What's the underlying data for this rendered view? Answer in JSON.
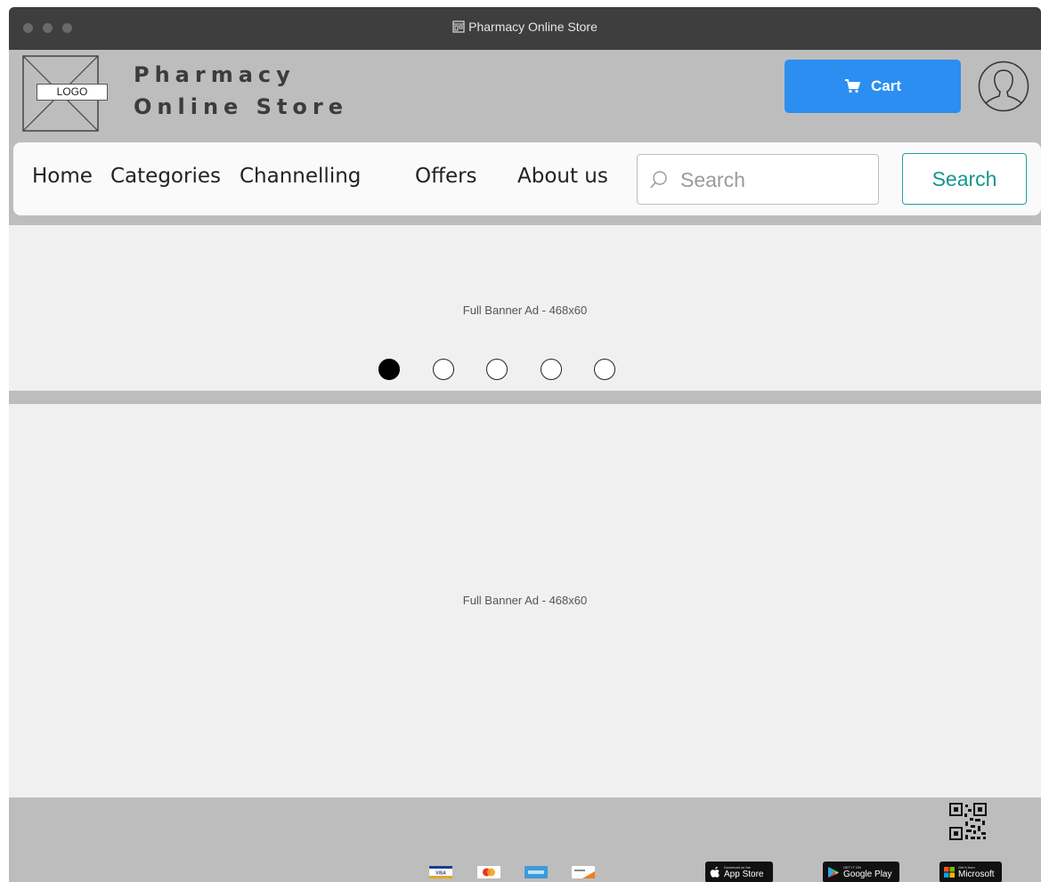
{
  "window": {
    "title": "Pharmacy Online Store"
  },
  "header": {
    "logo_label": "LOGO",
    "brand_line1": "Pharmacy",
    "brand_line2": "Online Store",
    "cart_label": "Cart"
  },
  "nav": {
    "items": [
      "Home",
      "Categories",
      "Channelling",
      "Offers",
      "About us"
    ],
    "search_placeholder": "Search",
    "search_button": "Search"
  },
  "banners": {
    "banner1_text": "Full Banner Ad - 468x60",
    "banner2_text": "Full Banner Ad - 468x60",
    "carousel_active_index": 0,
    "carousel_count": 5
  },
  "footer": {
    "payment_icons": [
      "visa-icon",
      "mastercard-icon",
      "amex-icon",
      "discover-icon"
    ],
    "stores": [
      {
        "small": "Download on the",
        "big": "App Store"
      },
      {
        "small": "GET IT ON",
        "big": "Google Play"
      },
      {
        "small": "Get it from",
        "big": "Microsoft"
      }
    ]
  }
}
